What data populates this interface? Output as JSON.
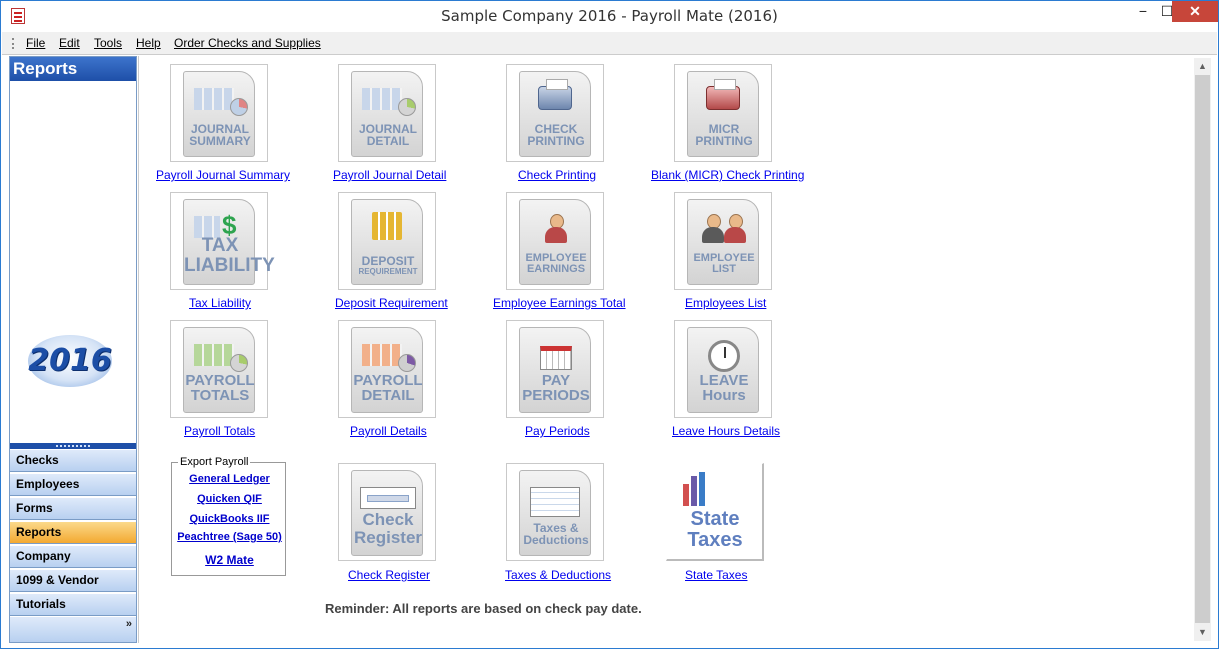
{
  "window": {
    "title": "Sample Company 2016 - Payroll Mate (2016)",
    "minimize": "−",
    "maximize": "☐",
    "close": "✕"
  },
  "menu": {
    "items": [
      "File",
      "Edit",
      "Tools",
      "Help",
      "Order Checks and Supplies"
    ]
  },
  "sidebar": {
    "header": "Reports",
    "badge": "2016",
    "buttons": [
      "Checks",
      "Employees",
      "Forms",
      "Reports",
      "Company",
      "1099 & Vendor",
      "Tutorials"
    ],
    "active": "Reports",
    "more": "»"
  },
  "reports": [
    {
      "icon_text": "JOURNAL SUMMARY",
      "link": "Payroll Journal Summary"
    },
    {
      "icon_text": "JOURNAL DETAIL",
      "link": "Payroll Journal Detail"
    },
    {
      "icon_text": "CHECK PRINTING",
      "link": "Check Printing"
    },
    {
      "icon_text": "MICR PRINTING",
      "link": "Blank (MICR) Check Printing"
    },
    {
      "icon_text": "TAX LIABILITY",
      "link": "Tax Liability"
    },
    {
      "icon_text": "DEPOSIT",
      "icon_sub": "REQUIREMENT",
      "link": "Deposit Requirement"
    },
    {
      "icon_text": "EMPLOYEE EARNINGS",
      "link": "Employee Earnings Total"
    },
    {
      "icon_text": "EMPLOYEE LIST",
      "link": "Employees List"
    },
    {
      "icon_text": "PAYROLL TOTALS",
      "link": "Payroll Totals"
    },
    {
      "icon_text": "PAYROLL DETAIL",
      "link": "Payroll Details"
    },
    {
      "icon_text": "PAY PERIODS",
      "link": "Pay Periods"
    },
    {
      "icon_text": "LEAVE Hours",
      "link": "Leave Hours Details"
    },
    {
      "icon_text": "Check Register",
      "link": "Check Register"
    },
    {
      "icon_text": "Taxes & Deductions",
      "link": "Taxes & Deductions"
    },
    {
      "icon_text": "State Taxes",
      "link": "State Taxes"
    }
  ],
  "export": {
    "title": "Export Payroll",
    "links": [
      "General Ledger",
      "Quicken QIF",
      "QuickBooks IIF",
      "Peachtree (Sage 50)",
      "W2 Mate"
    ]
  },
  "reminder": "Reminder: All reports are based on check pay date.",
  "colors": {
    "accent_blue": "#1e4fa8",
    "active_orange": "#f3a931",
    "link_blue": "#0000ee"
  }
}
